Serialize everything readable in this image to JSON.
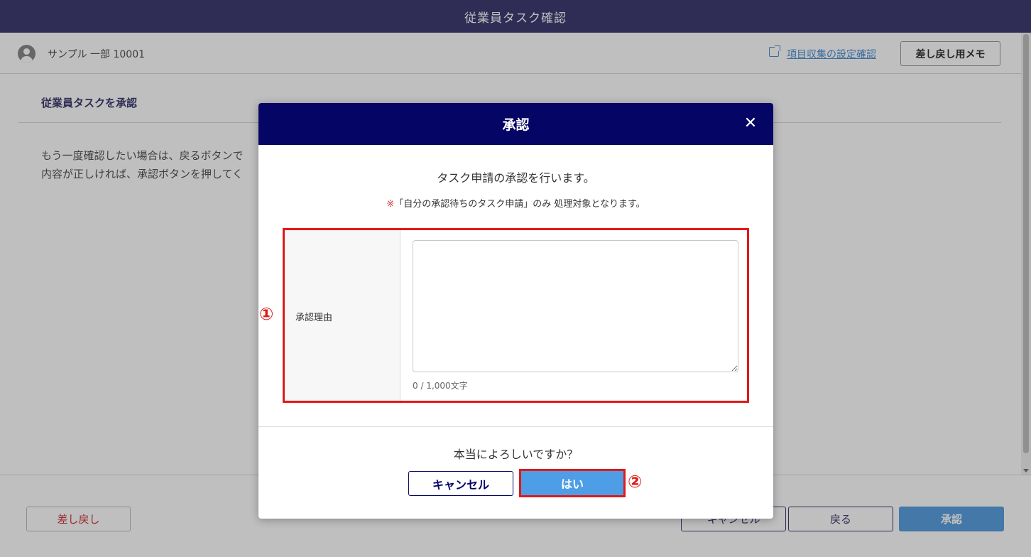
{
  "app": {
    "title": "従業員タスク確認"
  },
  "user": {
    "name": "サンプル 一部 10001"
  },
  "header_actions": {
    "settings_link": "項目収集の設定確認",
    "memo_button": "差し戻し用メモ"
  },
  "section": {
    "title": "従業員タスクを承認",
    "description_line1": "もう一度確認したい場合は、戻るボタンで",
    "description_line2": "内容が正しければ、承認ボタンを押してく"
  },
  "footer": {
    "reject": "差し戻し",
    "cancel": "キャンセル",
    "back": "戻る",
    "approve": "承認"
  },
  "modal": {
    "title": "承認",
    "message": "タスク申請の承認を行います。",
    "note_mark": "※",
    "note": "「自分の承認待ちのタスク申請」のみ 処理対象となります。",
    "field_label": "承認理由",
    "field_value": "",
    "char_count": "0 / 1,000文字",
    "confirm": "本当によろしいですか？",
    "cancel": "キャンセル",
    "yes": "はい"
  },
  "annotations": {
    "marker1": "①",
    "marker2": "②"
  },
  "colors": {
    "header": "#3f3d72",
    "modal_header": "#050566",
    "accent": "#4d9ee6",
    "highlight": "#e11919"
  }
}
